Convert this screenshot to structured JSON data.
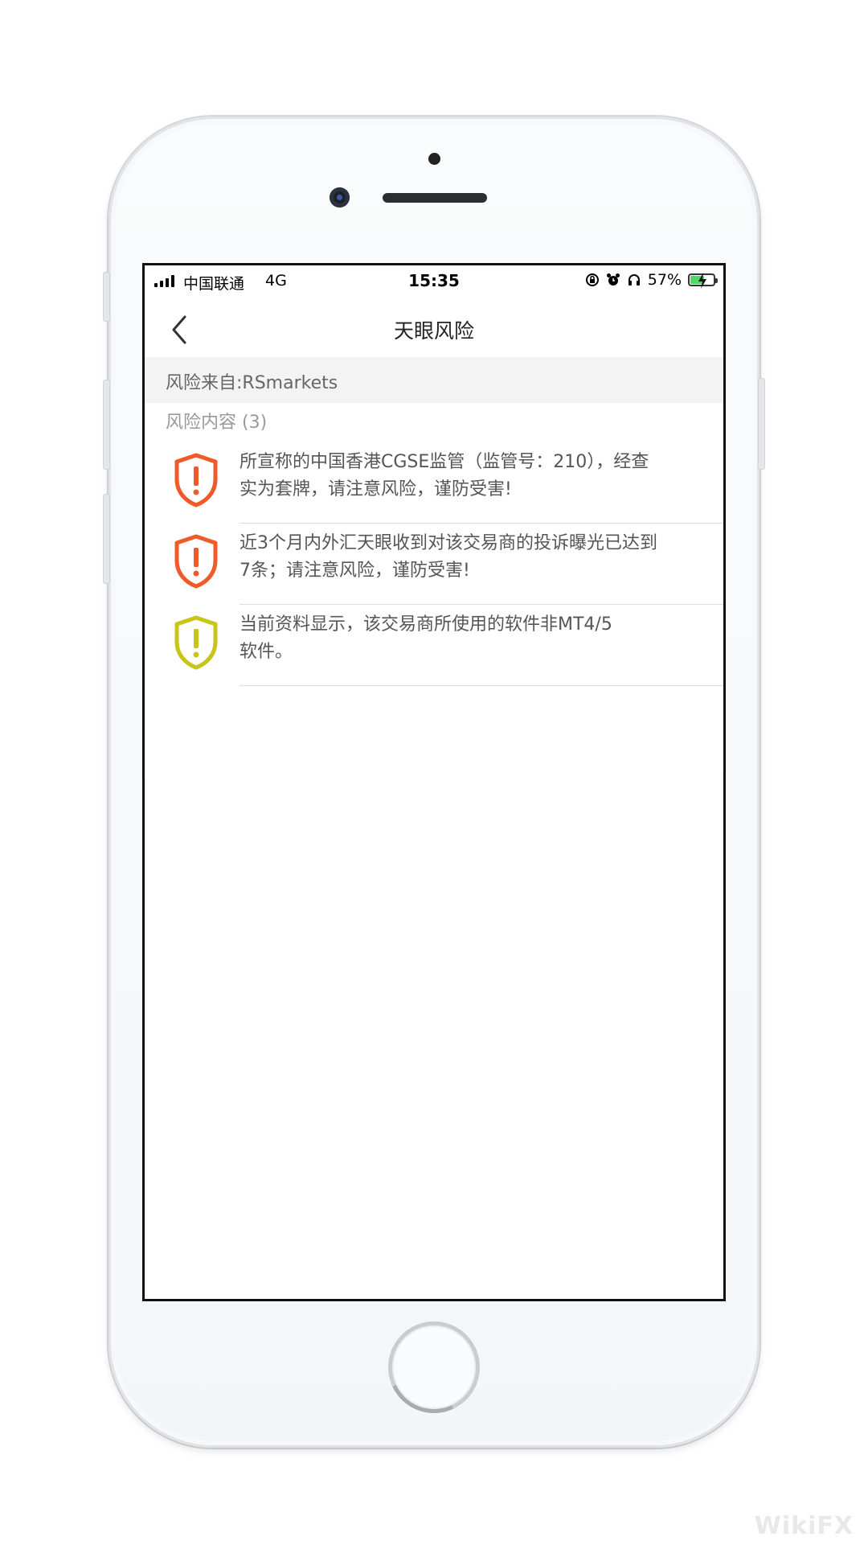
{
  "status_bar": {
    "carrier": "中国联通",
    "network": "4G",
    "time": "15:35",
    "battery_percent": "57%",
    "battery_level": 0.57,
    "battery_color": "#4cd964",
    "icons": [
      "rotation-lock-icon",
      "alarm-icon",
      "headphones-icon",
      "battery-icon"
    ]
  },
  "nav": {
    "back_icon": "chevron-left-icon",
    "title": "天眼风险"
  },
  "source": {
    "label": "风险来自:RSmarkets"
  },
  "section": {
    "title": "风险内容 (3)"
  },
  "risks": [
    {
      "level": "high",
      "icon": "shield-warning-icon",
      "color": "#f05a28",
      "text_line1": "所宣称的中国香港CGSE监管（监管号：210），经查",
      "text_line2": "实为套牌，请注意风险，谨防受害!"
    },
    {
      "level": "high",
      "icon": "shield-warning-icon",
      "color": "#f05a28",
      "text_line1": "近3个月内外汇天眼收到对该交易商的投诉曝光已达到",
      "text_line2": "7条；请注意风险，谨防受害!"
    },
    {
      "level": "medium",
      "icon": "shield-warning-icon",
      "color": "#c8c41a",
      "text_line1": "当前资料显示，该交易商所使用的软件非MT4/5",
      "text_line2": "软件。"
    }
  ],
  "watermark": "WikiFX"
}
